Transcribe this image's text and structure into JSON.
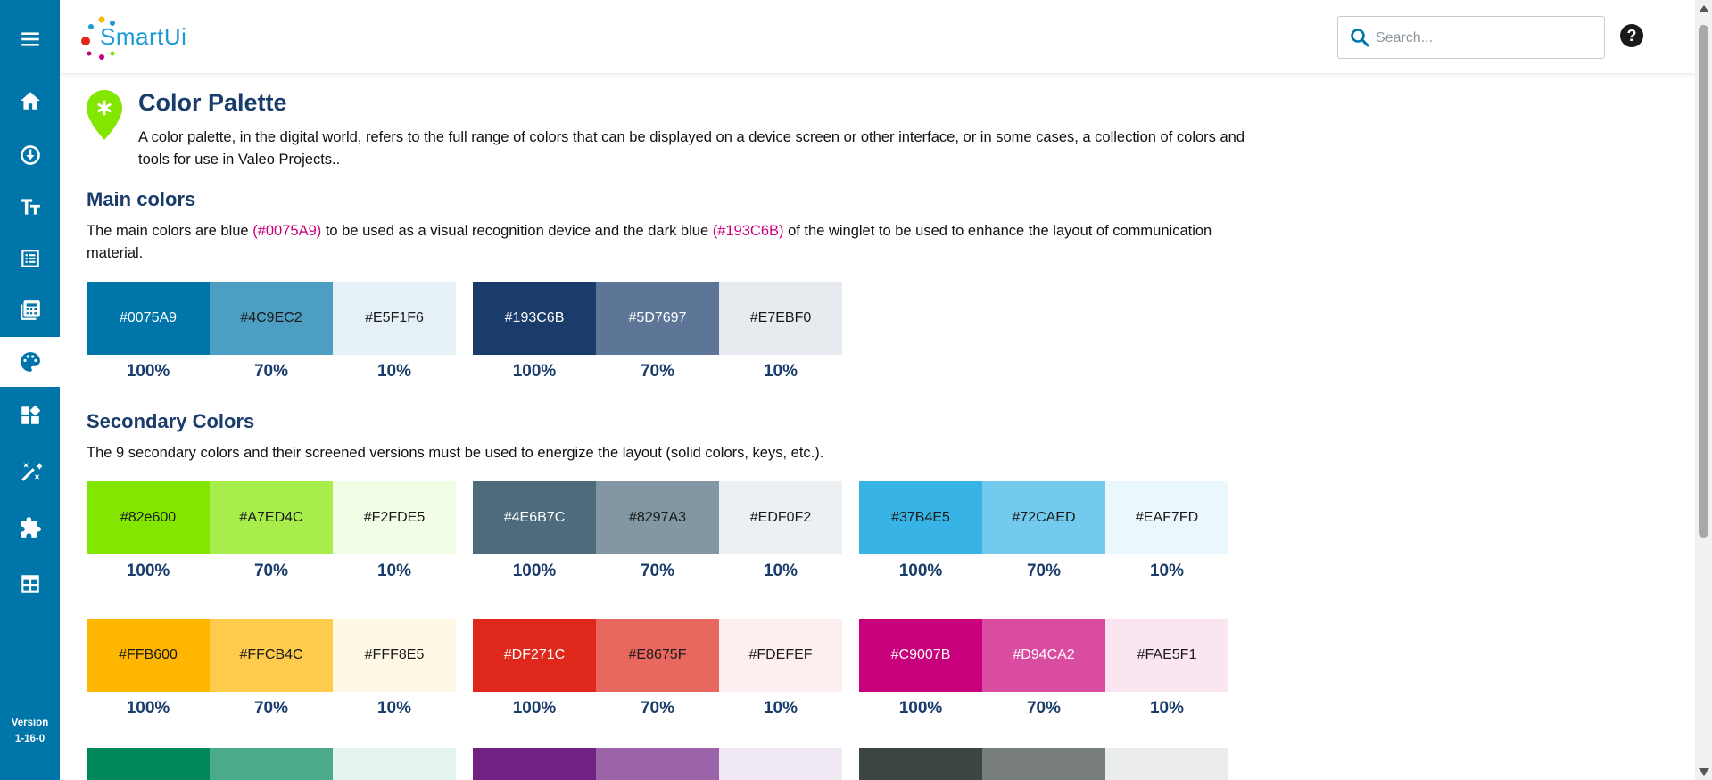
{
  "app": {
    "logo_text": "SmartUi",
    "version_label": "Version",
    "version_value": "1-16-0"
  },
  "colors": {
    "sidebar": "#0075A9",
    "title": "#193C6B",
    "highlight": "#C9007B",
    "logo_blue": "#1C9AD6"
  },
  "sidebar": {
    "items": [
      {
        "icon": "menu-icon"
      },
      {
        "icon": "home-icon"
      },
      {
        "icon": "download-icon"
      },
      {
        "icon": "typography-icon"
      },
      {
        "icon": "list-icon"
      },
      {
        "icon": "calculator-icon"
      },
      {
        "icon": "palette-icon",
        "active": true
      },
      {
        "icon": "dashboard-icon"
      },
      {
        "icon": "magic-wand-icon"
      },
      {
        "icon": "puzzle-icon"
      },
      {
        "icon": "table-icon"
      }
    ]
  },
  "header": {
    "search_placeholder": "Search...",
    "help_label": "?"
  },
  "page": {
    "title": "Color Palette",
    "intro": "A color palette, in the digital world, refers to the full range of colors that can be displayed on a device screen or other interface, or in some cases, a collection of colors and tools for use in Valeo Projects..",
    "main_heading": "Main colors",
    "main_text_1": "The main colors are blue ",
    "main_hl_1": "(#0075A9)",
    "main_text_2": " to be used as a visual recognition device and the dark blue ",
    "main_hl_2": "(#193C6B)",
    "main_text_3": " of the winglet to be used to enhance the layout of communication material.",
    "secondary_heading": "Secondary Colors",
    "secondary_text": "The 9 secondary colors and their screened versions must be used to energize the layout (solid colors, keys, etc.)."
  },
  "main_groups": [
    [
      {
        "hex": "#0075A9",
        "pct": "100%",
        "text": "#ffffff"
      },
      {
        "hex": "#4C9EC2",
        "pct": "70%",
        "text": "#1a1a1a"
      },
      {
        "hex": "#E5F1F6",
        "pct": "10%",
        "text": "#1a1a1a"
      }
    ],
    [
      {
        "hex": "#193C6B",
        "pct": "100%",
        "text": "#ffffff"
      },
      {
        "hex": "#5D7697",
        "pct": "70%",
        "text": "#ffffff"
      },
      {
        "hex": "#E7EBF0",
        "pct": "10%",
        "text": "#1a1a1a"
      }
    ]
  ],
  "secondary_rows": [
    [
      [
        {
          "hex": "#82e600",
          "pct": "100%",
          "text": "#1a1a1a"
        },
        {
          "hex": "#A7ED4C",
          "pct": "70%",
          "text": "#1a1a1a"
        },
        {
          "hex": "#F2FDE5",
          "pct": "10%",
          "text": "#1a1a1a"
        }
      ],
      [
        {
          "hex": "#4E6B7C",
          "pct": "100%",
          "text": "#ffffff"
        },
        {
          "hex": "#8297A3",
          "pct": "70%",
          "text": "#1a1a1a"
        },
        {
          "hex": "#EDF0F2",
          "pct": "10%",
          "text": "#1a1a1a"
        }
      ],
      [
        {
          "hex": "#37B4E5",
          "pct": "100%",
          "text": "#1a1a1a"
        },
        {
          "hex": "#72CAED",
          "pct": "70%",
          "text": "#1a1a1a"
        },
        {
          "hex": "#EAF7FD",
          "pct": "10%",
          "text": "#1a1a1a"
        }
      ]
    ],
    [
      [
        {
          "hex": "#FFB600",
          "pct": "100%",
          "text": "#1a1a1a"
        },
        {
          "hex": "#FFCB4C",
          "pct": "70%",
          "text": "#1a1a1a"
        },
        {
          "hex": "#FFF8E5",
          "pct": "10%",
          "text": "#1a1a1a"
        }
      ],
      [
        {
          "hex": "#DF271C",
          "pct": "100%",
          "text": "#ffffff"
        },
        {
          "hex": "#E8675F",
          "pct": "70%",
          "text": "#1a1a1a"
        },
        {
          "hex": "#FDEFEF",
          "pct": "10%",
          "text": "#1a1a1a"
        }
      ],
      [
        {
          "hex": "#C9007B",
          "pct": "100%",
          "text": "#ffffff"
        },
        {
          "hex": "#D94CA2",
          "pct": "70%",
          "text": "#ffffff"
        },
        {
          "hex": "#FAE5F1",
          "pct": "10%",
          "text": "#1a1a1a"
        }
      ]
    ]
  ]
}
